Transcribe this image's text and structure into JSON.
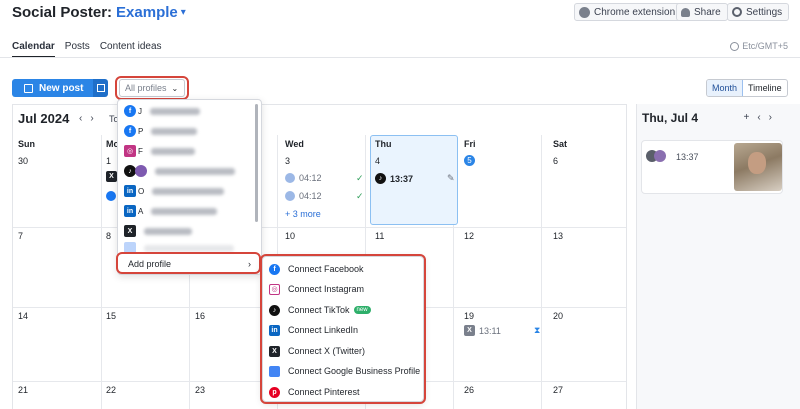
{
  "header": {
    "title": "Social Poster:",
    "project": "Example",
    "buttons": [
      "Chrome extension",
      "Share",
      "Settings"
    ]
  },
  "tabs": [
    "Calendar",
    "Posts",
    "Content ideas"
  ],
  "timezone": "Etc/GMT+5",
  "toolbar": {
    "new_post": "New post",
    "profiles_select": "All profiles",
    "views": [
      "Month",
      "Timeline"
    ]
  },
  "calendar": {
    "month": "Jul 2024",
    "today_label": "To",
    "day_names": [
      "Sun",
      "Mo",
      "Wed",
      "Thu",
      "Fri",
      "Sat"
    ],
    "week1": [
      "30",
      "1",
      "3",
      "4",
      "5",
      "6"
    ],
    "week2": [
      "7",
      "8",
      "10",
      "11",
      "12",
      "13"
    ],
    "week3": [
      "14",
      "15",
      "16",
      "19",
      "20"
    ],
    "week4": [
      "21",
      "22",
      "23",
      "26",
      "27"
    ],
    "posts": {
      "wed_1": "04:12",
      "wed_2": "04:12",
      "wed_more": "+ 3 more",
      "thu": "13:37",
      "fri19": "13:11"
    }
  },
  "side": {
    "title": "Thu, Jul 4",
    "post_time": "13:37"
  },
  "dropdown": {
    "initials": [
      "J",
      "P",
      "F",
      "",
      "O",
      "A"
    ],
    "add_profile": "Add profile"
  },
  "submenu": {
    "items": [
      "Connect Facebook",
      "Connect Instagram",
      "Connect TikTok",
      "Connect LinkedIn",
      "Connect X (Twitter)",
      "Connect Google Business Profile",
      "Connect Pinterest"
    ],
    "new_badge": "new"
  },
  "colors": {
    "accent": "#2b85e6",
    "highlight": "#d5453b",
    "facebook": "#1877f2",
    "instagram": "#c13584",
    "linkedin": "#0a66c2",
    "pinterest": "#e60023",
    "x": "#1f2329",
    "tiktok": "#111111",
    "google": "#4285f4"
  }
}
